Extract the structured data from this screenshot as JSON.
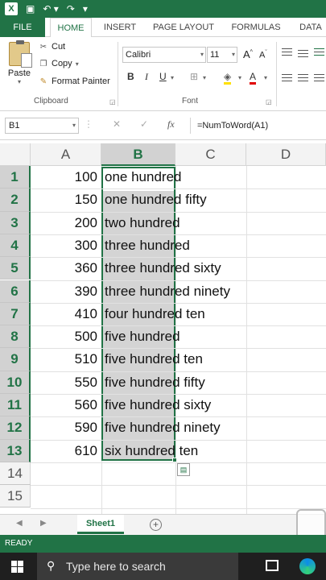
{
  "qat": {
    "app_icon": "X"
  },
  "tabs": [
    "FILE",
    "HOME",
    "INSERT",
    "PAGE LAYOUT",
    "FORMULAS",
    "DATA"
  ],
  "clipboard": {
    "paste": "Paste",
    "cut": "Cut",
    "copy": "Copy",
    "format_painter": "Format Painter",
    "label": "Clipboard"
  },
  "font": {
    "name": "Calibri",
    "size": "11",
    "grow": "A",
    "shrink": "A",
    "bold": "B",
    "italic": "I",
    "underline": "U",
    "color_letter": "A",
    "label": "Font"
  },
  "formula_bar": {
    "name_box": "B1",
    "fx": "fx",
    "formula": "=NumToWord(A1)"
  },
  "columns": [
    "A",
    "B",
    "C",
    "D"
  ],
  "rows": [
    {
      "num": "1",
      "a": "100",
      "b": "one hundred"
    },
    {
      "num": "2",
      "a": "150",
      "b": "one hundred fifty"
    },
    {
      "num": "3",
      "a": "200",
      "b": "two hundred"
    },
    {
      "num": "4",
      "a": "300",
      "b": "three hundred"
    },
    {
      "num": "5",
      "a": "360",
      "b": "three hundred sixty"
    },
    {
      "num": "6",
      "a": "390",
      "b": "three hundred ninety"
    },
    {
      "num": "7",
      "a": "410",
      "b": "four hundred ten"
    },
    {
      "num": "8",
      "a": "500",
      "b": "five hundred"
    },
    {
      "num": "9",
      "a": "510",
      "b": "five hundred ten"
    },
    {
      "num": "10",
      "a": "550",
      "b": "five hundred fifty"
    },
    {
      "num": "11",
      "a": "560",
      "b": "five hundred sixty"
    },
    {
      "num": "12",
      "a": "590",
      "b": "five hundred ninety"
    },
    {
      "num": "13",
      "a": "610",
      "b": "six hundred ten"
    },
    {
      "num": "14",
      "a": "",
      "b": ""
    },
    {
      "num": "15",
      "a": "",
      "b": ""
    }
  ],
  "sheet": {
    "tab": "Sheet1",
    "add": "+"
  },
  "status": "READY",
  "taskbar": {
    "search_placeholder": "Type here to search"
  },
  "colors": {
    "accent": "#217346",
    "selection": "#a0a0a0"
  }
}
